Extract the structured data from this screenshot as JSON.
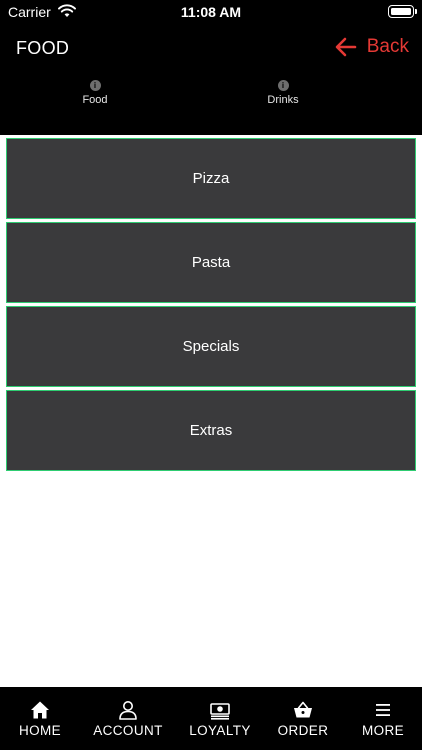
{
  "status_bar": {
    "carrier": "Carrier",
    "time": "11:08 AM",
    "icons": [
      "wifi-icon",
      "battery-icon"
    ]
  },
  "header": {
    "title": "FOOD",
    "back_label": "Back",
    "accent_color": "#e53935",
    "background": "#000000"
  },
  "tabs": [
    {
      "label": "Food",
      "icon": "info-icon"
    },
    {
      "label": "Drinks",
      "icon": "info-icon"
    }
  ],
  "menu": {
    "items": [
      {
        "label": "Pizza"
      },
      {
        "label": "Pasta"
      },
      {
        "label": "Specials"
      },
      {
        "label": "Extras"
      }
    ],
    "tile_color": "#3a3a3c",
    "border_color": "#2ecc71"
  },
  "bottom_nav": {
    "items": [
      {
        "label": "HOME",
        "icon": "home-icon"
      },
      {
        "label": "ACCOUNT",
        "icon": "user-icon"
      },
      {
        "label": "LOYALTY",
        "icon": "money-icon"
      },
      {
        "label": "ORDER",
        "icon": "basket-icon"
      },
      {
        "label": "MORE",
        "icon": "menu-icon"
      }
    ]
  }
}
